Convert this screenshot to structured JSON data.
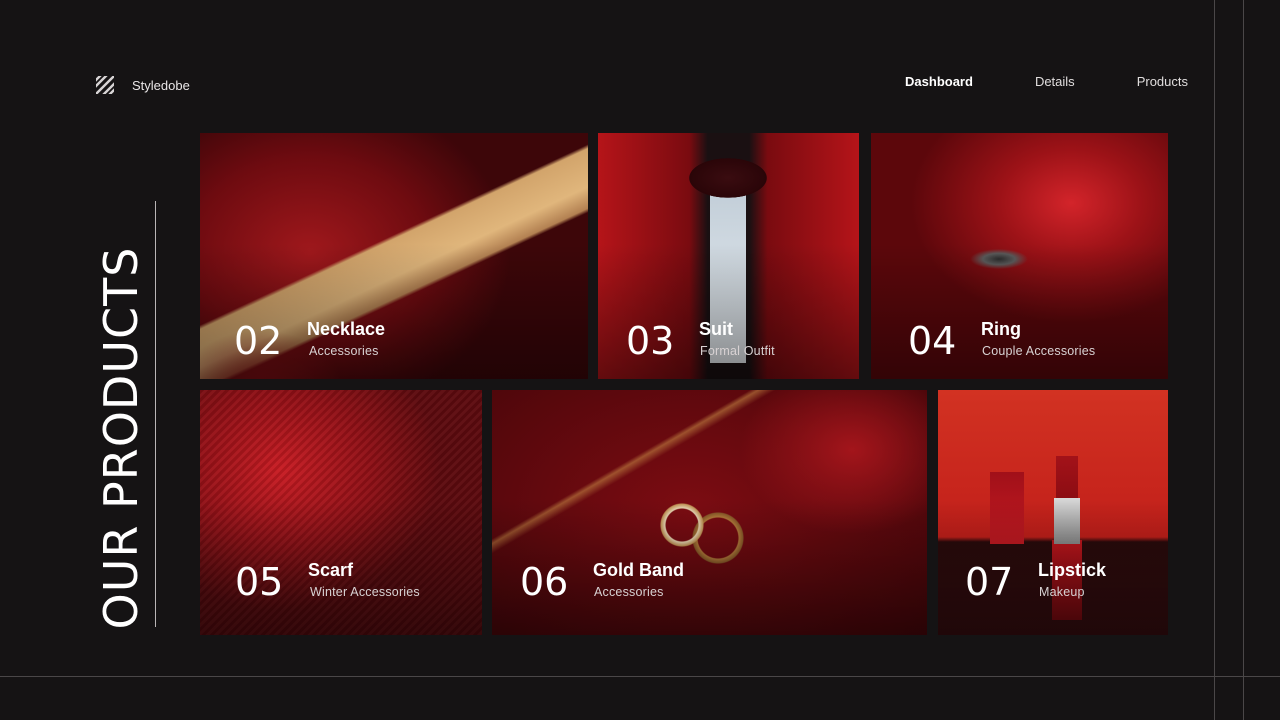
{
  "brand": {
    "name": "Styledobe",
    "logo_icon": "striped-square-logo-icon"
  },
  "nav": {
    "items": [
      "Dashboard",
      "Details",
      "Products"
    ],
    "active": "Dashboard"
  },
  "section_title": "OUR PRODUCTS",
  "products": [
    {
      "number": "02",
      "name": "Necklace",
      "category": "Accessories"
    },
    {
      "number": "03",
      "name": "Suit",
      "category": "Formal Outfit"
    },
    {
      "number": "04",
      "name": "Ring",
      "category": "Couple Accessories"
    },
    {
      "number": "05",
      "name": "Scarf",
      "category": "Winter Accessories"
    },
    {
      "number": "06",
      "name": "Gold Band",
      "category": "Accessories"
    },
    {
      "number": "07",
      "name": "Lipstick",
      "category": "Makeup"
    }
  ],
  "colors": {
    "background": "#151314",
    "accent": "#a3151b",
    "text": "#ffffff"
  }
}
